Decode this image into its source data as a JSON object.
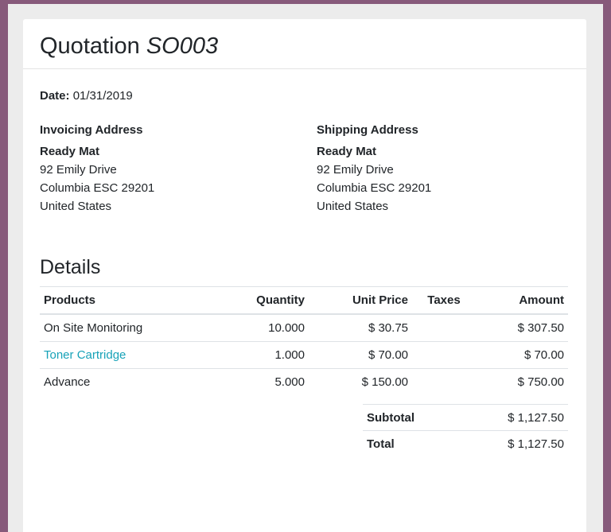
{
  "quotation": {
    "label": "Quotation",
    "number": "SO003"
  },
  "date": {
    "label": "Date:",
    "value": "01/31/2019"
  },
  "invoicing": {
    "heading": "Invoicing Address",
    "name": "Ready Mat",
    "street": "92 Emily Drive",
    "city": "Columbia ESC 29201",
    "country": "United States"
  },
  "shipping": {
    "heading": "Shipping Address",
    "name": "Ready Mat",
    "street": "92 Emily Drive",
    "city": "Columbia ESC 29201",
    "country": "United States"
  },
  "details": {
    "title": "Details",
    "columns": [
      "Products",
      "Quantity",
      "Unit Price",
      "Taxes",
      "Amount"
    ],
    "lines": [
      {
        "product": "On Site Monitoring",
        "quantity": "10.000",
        "unit_price": "$ 30.75",
        "taxes": "",
        "amount": "$ 307.50"
      },
      {
        "product": "Toner Cartridge",
        "quantity": "1.000",
        "unit_price": "$ 70.00",
        "taxes": "",
        "amount": "$ 70.00"
      },
      {
        "product": "Advance",
        "quantity": "5.000",
        "unit_price": "$ 150.00",
        "taxes": "",
        "amount": "$ 750.00"
      }
    ]
  },
  "totals": {
    "subtotal_label": "Subtotal",
    "subtotal": "$ 1,127.50",
    "total_label": "Total",
    "total": "$ 1,127.50"
  },
  "colors": {
    "background": "#875a7b",
    "link": "#17a2b8"
  }
}
